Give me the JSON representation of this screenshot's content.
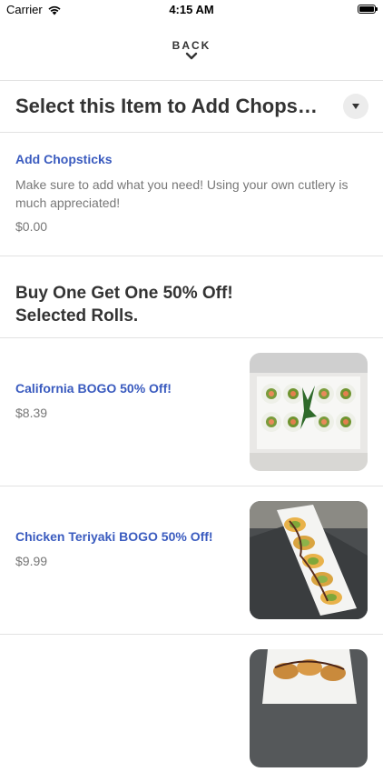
{
  "status_bar": {
    "carrier": "Carrier",
    "time": "4:15 AM",
    "battery_level": 1.0
  },
  "nav": {
    "back_label": "BACK"
  },
  "section": {
    "title": "Select this Item to Add Chops…"
  },
  "chopsticks": {
    "name": "Add Chopsticks",
    "description": "Make sure to add what you need! Using your own cutlery is much appreciated!",
    "price": "$0.00"
  },
  "promo": {
    "line1": "Buy One Get One 50% Off!",
    "line2": "Selected Rolls."
  },
  "items": [
    {
      "name": "California BOGO 50% Off!",
      "price": "$8.39",
      "image": "california-roll-photo"
    },
    {
      "name": "Chicken Teriyaki BOGO 50% Off!",
      "price": "$9.99",
      "image": "chicken-teriyaki-roll-photo"
    },
    {
      "name": "",
      "price": "",
      "image": "sushi-roll-photo"
    }
  ],
  "colors": {
    "link": "#3a5bbf",
    "text": "#333333",
    "muted": "#777777",
    "divider": "#e2e2e2"
  }
}
